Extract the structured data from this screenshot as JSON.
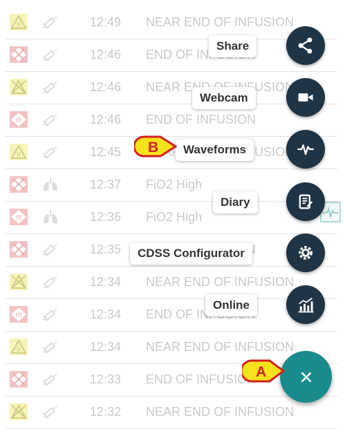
{
  "alarms": [
    {
      "severity": "medium",
      "type": "syringe",
      "time": "12:49",
      "message": "NEAR END OF INFUSION"
    },
    {
      "severity": "high-muted",
      "type": "syringe",
      "time": "12:46",
      "message": "END OF INFUSION"
    },
    {
      "severity": "medium-muted",
      "type": "syringe",
      "time": "12:46",
      "message": "NEAR END OF INFUSION"
    },
    {
      "severity": "high",
      "type": "syringe",
      "time": "12:46",
      "message": "END OF INFUSION"
    },
    {
      "severity": "medium",
      "type": "syringe",
      "time": "12:45",
      "message": "NEAR END OF INFUSION"
    },
    {
      "severity": "high-muted",
      "type": "lungs",
      "time": "12:37",
      "message": "FiO2 High"
    },
    {
      "severity": "high",
      "type": "lungs",
      "time": "12:36",
      "message": "FiO2 High"
    },
    {
      "severity": "high-muted",
      "type": "syringe",
      "time": "12:35",
      "message": "END OF INFUSION"
    },
    {
      "severity": "medium-muted",
      "type": "syringe",
      "time": "12:34",
      "message": "NEAR END OF INFUSION"
    },
    {
      "severity": "high",
      "type": "syringe",
      "time": "12:34",
      "message": "END OF INFUSION"
    },
    {
      "severity": "medium",
      "type": "syringe",
      "time": "12:34",
      "message": "NEAR END OF INFUSION"
    },
    {
      "severity": "high-muted",
      "type": "syringe",
      "time": "12:33",
      "message": "END OF INFUSION"
    },
    {
      "severity": "medium-muted",
      "type": "syringe",
      "time": "12:32",
      "message": "NEAR END OF INFUSION"
    }
  ],
  "menu": {
    "share": {
      "label": "Share",
      "icon": "share-icon"
    },
    "webcam": {
      "label": "Webcam",
      "icon": "videocam-icon"
    },
    "waveforms": {
      "label": "Waveforms",
      "icon": "waveform-icon"
    },
    "diary": {
      "label": "Diary",
      "icon": "notebook-icon"
    },
    "cdss": {
      "label": "CDSS Configurator",
      "icon": "gear-shield-icon"
    },
    "online": {
      "label": "Online",
      "icon": "chart-icon"
    }
  },
  "main_button": {
    "icon": "close-icon"
  },
  "callouts": {
    "a": "A",
    "b": "B"
  },
  "colors": {
    "fab_dark": "#1f3444",
    "fab_main": "#1a8b8d",
    "callout_fill": "#f7e21b",
    "callout_border": "#d0201f",
    "medium_bg": "#f4ef9c",
    "high_bg": "#eeaaaa"
  }
}
